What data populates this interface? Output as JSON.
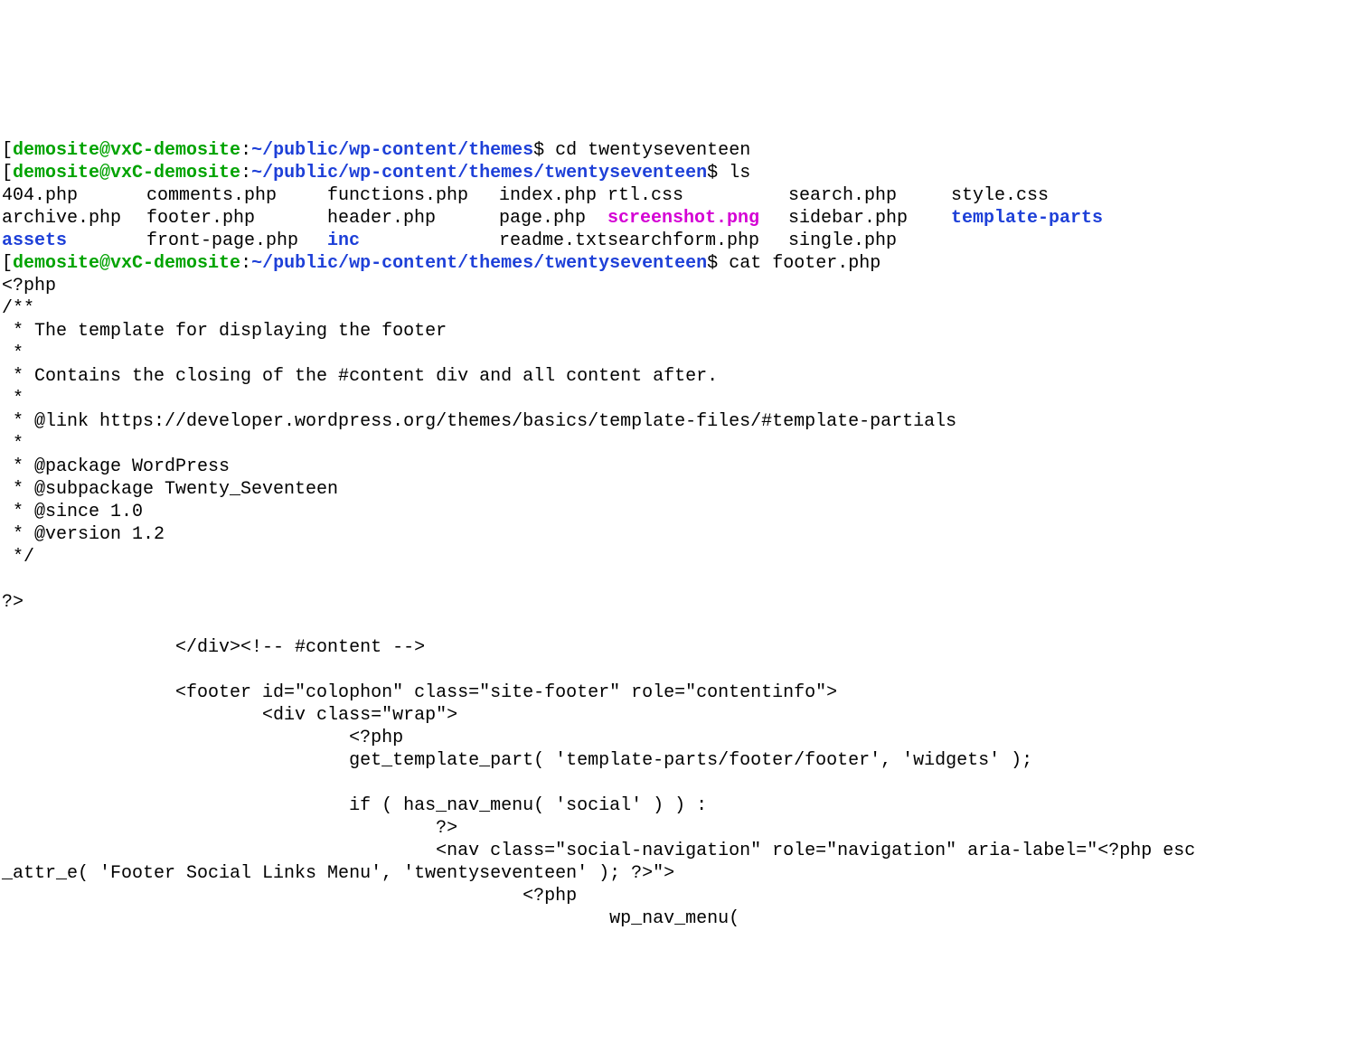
{
  "prompt1": {
    "user_host": "demosite@vxC-demosite",
    "colon": ":",
    "path": "~/public/wp-content/themes",
    "dollar": "$ ",
    "cmd": "cd twentyseventeen"
  },
  "prompt2": {
    "user_host": "demosite@vxC-demosite",
    "colon": ":",
    "path": "~/public/wp-content/themes/twentyseventeen",
    "dollar": "$ ",
    "cmd": "ls"
  },
  "ls": {
    "r0": {
      "c0": "404.php",
      "c1": "comments.php",
      "c2": "functions.php",
      "c3": "index.php",
      "c4": "rtl.css",
      "c5": "search.php",
      "c6": "style.css"
    },
    "r1": {
      "c0": "archive.php",
      "c1": "footer.php",
      "c2": "header.php",
      "c3": "page.php",
      "c4": "screenshot.png",
      "c5": "sidebar.php",
      "c6": "template-parts"
    },
    "r2": {
      "c0": "assets",
      "c1": "front-page.php",
      "c2": "inc",
      "c3": "readme.txt",
      "c4": "searchform.php",
      "c5": "single.php",
      "c6": ""
    }
  },
  "prompt3": {
    "user_host": "demosite@vxC-demosite",
    "colon": ":",
    "path": "~/public/wp-content/themes/twentyseventeen",
    "dollar": "$ ",
    "cmd": "cat footer.php"
  },
  "file": {
    "l00": "<?php",
    "l01": "/**",
    "l02": " * The template for displaying the footer",
    "l03": " *",
    "l04": " * Contains the closing of the #content div and all content after.",
    "l05": " *",
    "l06": " * @link https://developer.wordpress.org/themes/basics/template-files/#template-partials",
    "l07": " *",
    "l08": " * @package WordPress",
    "l09": " * @subpackage Twenty_Seventeen",
    "l10": " * @since 1.0",
    "l11": " * @version 1.2",
    "l12": " */",
    "l13": "",
    "l14": "?>",
    "l15": "",
    "l16": "                </div><!-- #content -->",
    "l17": "",
    "l18": "                <footer id=\"colophon\" class=\"site-footer\" role=\"contentinfo\">",
    "l19": "                        <div class=\"wrap\">",
    "l20": "                                <?php",
    "l21": "                                get_template_part( 'template-parts/footer/footer', 'widgets' );",
    "l22": "",
    "l23": "                                if ( has_nav_menu( 'social' ) ) :",
    "l24": "                                        ?>",
    "l25a": "                                        <nav class=\"social-navigation\" role=\"navigation\" aria-label=\"<?php esc",
    "l25b": "_attr_e( 'Footer Social Links Menu', 'twentyseventeen' ); ?>\">",
    "l26": "                                                <?php",
    "l27": "                                                        wp_nav_menu("
  }
}
